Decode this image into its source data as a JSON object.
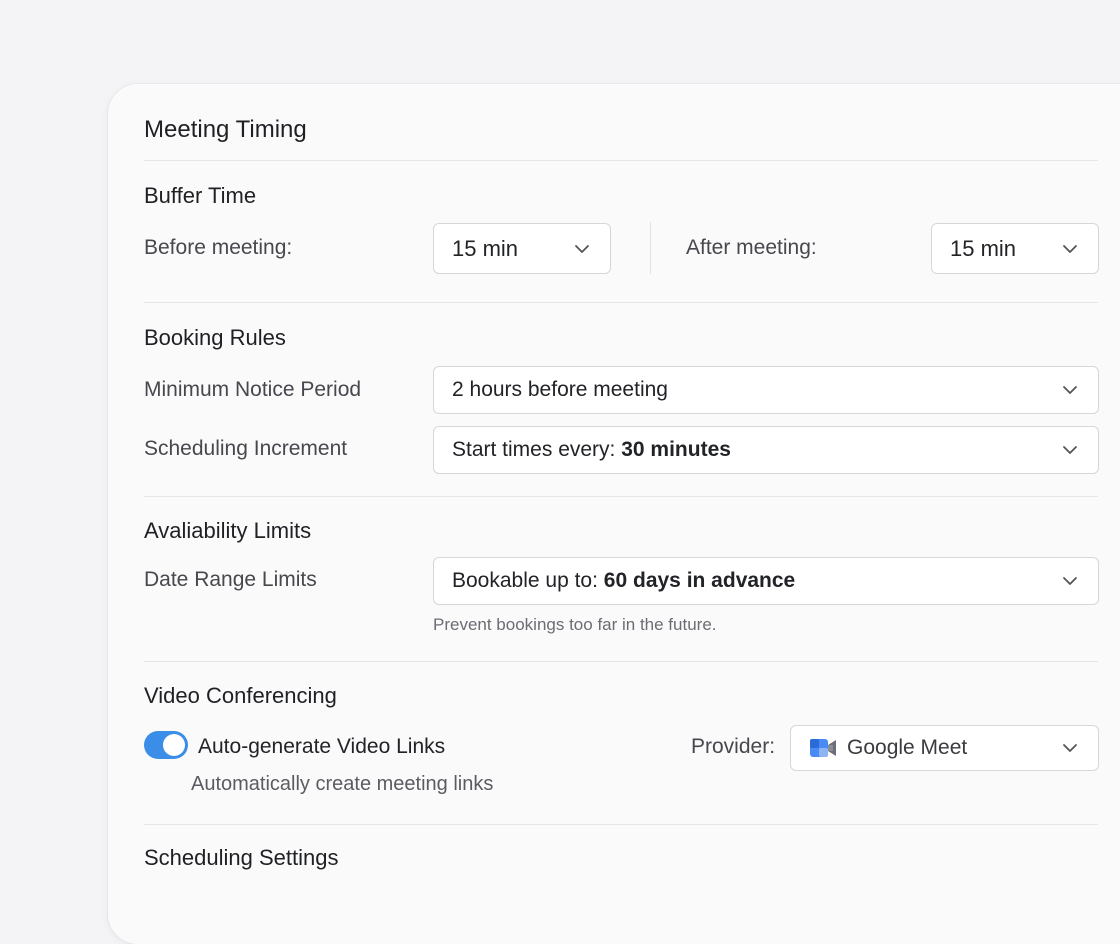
{
  "card": {
    "title": "Meeting Timing"
  },
  "buffer_time": {
    "title": "Buffer Time",
    "before_label": "Before meeting:",
    "before_value": "15 min",
    "after_label": "After meeting:",
    "after_value": "15 min"
  },
  "booking_rules": {
    "title": "Booking Rules",
    "min_notice_label": "Minimum Notice Period",
    "min_notice_value": "2 hours before meeting",
    "increment_label": "Scheduling Increment",
    "increment_prefix": "Start times every:",
    "increment_value": "30 minutes"
  },
  "availability_limits": {
    "title": "Avaliability Limits",
    "date_range_label": "Date Range Limits",
    "date_range_prefix": "Bookable up to:",
    "date_range_value": "60 days in advance",
    "date_range_helper": "Prevent bookings too far in the future."
  },
  "video_conferencing": {
    "title": "Video Conferencing",
    "toggle_label": "Auto-generate Video Links",
    "toggle_on": true,
    "toggle_helper": "Automatically create meeting links",
    "provider_label": "Provider:",
    "provider_value": "Google Meet",
    "provider_icon": "google-meet-icon"
  },
  "scheduling_settings": {
    "title": "Scheduling Settings"
  },
  "colors": {
    "accent": "#3b8ee8",
    "card_bg": "#fafafb",
    "page_bg": "#f4f4f6"
  }
}
